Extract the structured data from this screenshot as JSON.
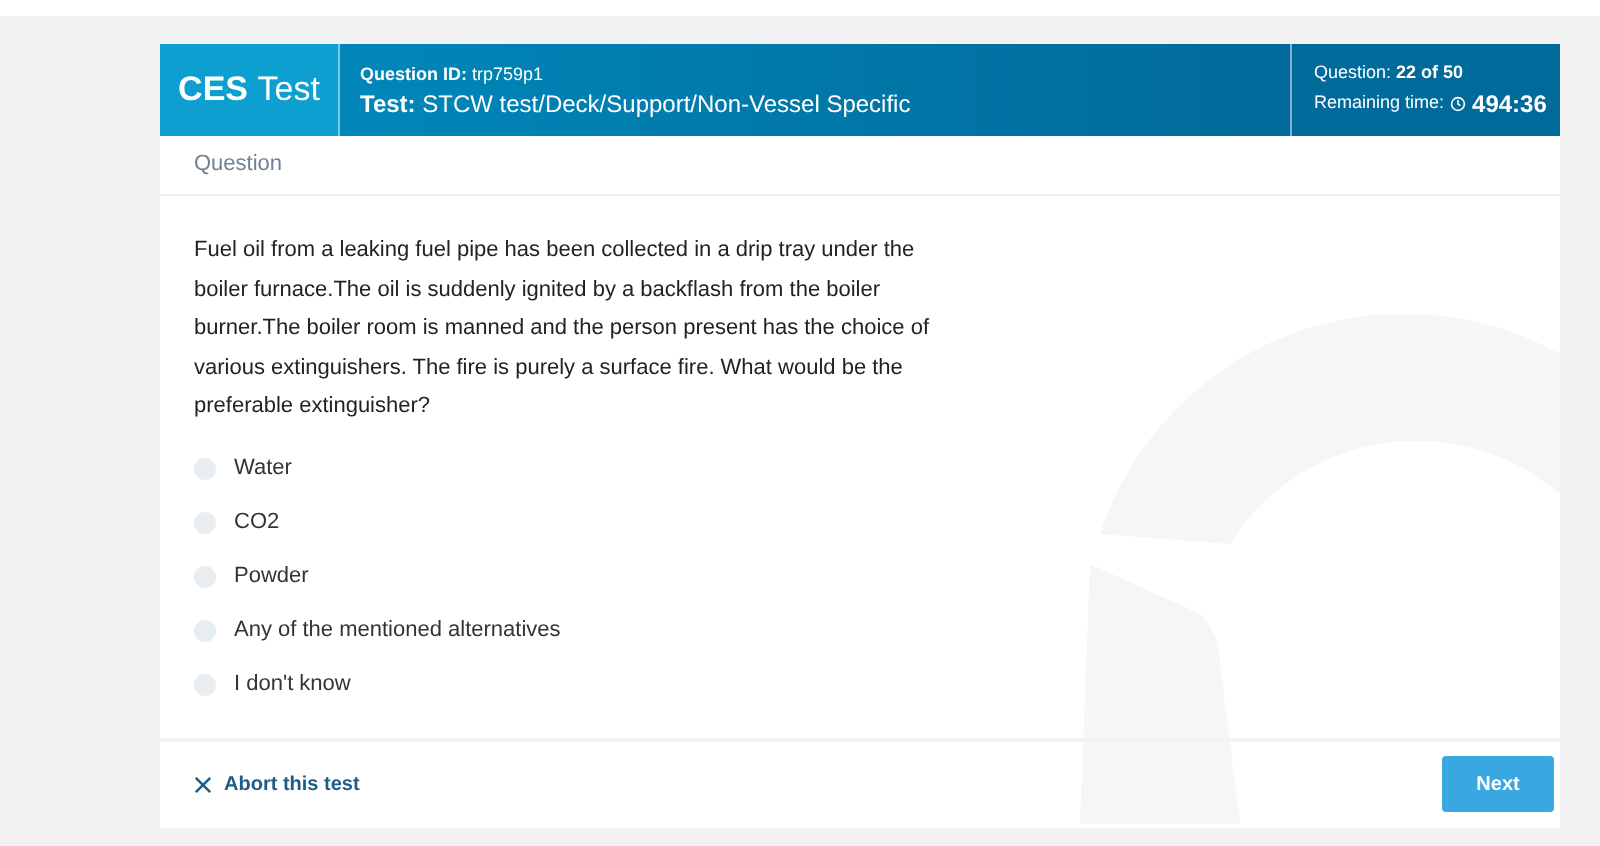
{
  "header": {
    "brand_bold": "CES",
    "brand_light": "Test",
    "question_id_label": "Question ID:",
    "question_id": "trp759p1",
    "test_label": "Test:",
    "test_path": "STCW test/Deck/Support/Non-Vessel Specific",
    "progress_label": "Question:",
    "progress": "22 of 50",
    "time_label": "Remaining time:",
    "time": "494:36"
  },
  "section_title": "Question",
  "question": "Fuel oil from a leaking fuel pipe has been collected in a drip tray under the boiler furnace.The oil is suddenly ignited by a backflash from the boiler burner.The boiler room is manned and the person present has the choice of various extinguishers. The fire is purely a surface fire. What would be the preferable extinguisher?",
  "answers": [
    {
      "label": "Water",
      "selected": false
    },
    {
      "label": "CO2",
      "selected": false
    },
    {
      "label": "Powder",
      "selected": false
    },
    {
      "label": "Any of the mentioned alternatives",
      "selected": false
    },
    {
      "label": "I don't know",
      "selected": false
    }
  ],
  "footer": {
    "abort": "Abort this test",
    "next": "Next"
  }
}
